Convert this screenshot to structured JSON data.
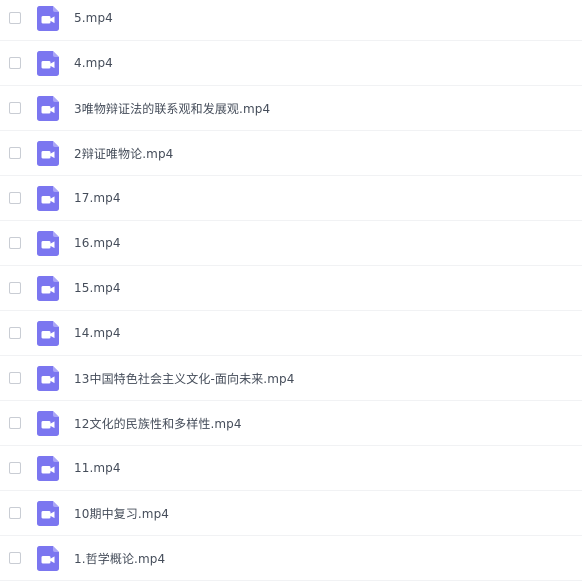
{
  "colors": {
    "icon_primary": "#7b76f0",
    "icon_fold": "#aaa6f7",
    "text": "#454d5a",
    "divider": "#f1f2f4",
    "checkbox_border": "#c9cdd4"
  },
  "icon": "video-file-icon",
  "files": [
    {
      "name": "5.mp4"
    },
    {
      "name": "4.mp4"
    },
    {
      "name": "3唯物辩证法的联系观和发展观.mp4"
    },
    {
      "name": "2辩证唯物论.mp4"
    },
    {
      "name": "17.mp4"
    },
    {
      "name": "16.mp4"
    },
    {
      "name": "15.mp4"
    },
    {
      "name": "14.mp4"
    },
    {
      "name": "13中国特色社会主义文化-面向未来.mp4"
    },
    {
      "name": "12文化的民族性和多样性.mp4"
    },
    {
      "name": "11.mp4"
    },
    {
      "name": "10期中复习.mp4"
    },
    {
      "name": "1.哲学概论.mp4"
    }
  ]
}
